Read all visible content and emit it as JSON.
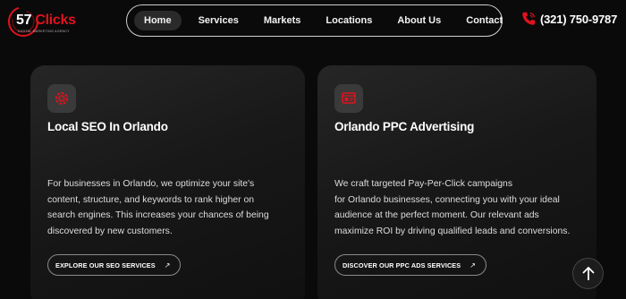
{
  "logo": {
    "number": "57",
    "word": "Clicks",
    "tagline": "DIGITAL MARKETING AGENCY"
  },
  "nav": {
    "items": [
      {
        "label": "Home",
        "active": true
      },
      {
        "label": "Services"
      },
      {
        "label": "Markets"
      },
      {
        "label": "Locations"
      },
      {
        "label": "About Us"
      },
      {
        "label": "Contact"
      }
    ]
  },
  "phone": {
    "number": "(321) 750-9787",
    "icon": "phone-icon"
  },
  "cards": [
    {
      "icon": "seo-gear-icon",
      "title": "Local SEO In Orlando",
      "desc": [
        "For businesses in Orlando, we optimize your site's",
        "content, structure, and keywords to rank higher on",
        "search engines. This increases your chances of being",
        "discovered by new customers."
      ],
      "button": "EXPLORE OUR SEO SERVICES",
      "button_icon": "arrow-up-right-icon"
    },
    {
      "icon": "ppc-ad-icon",
      "title": "Orlando PPC Advertising",
      "desc": [
        "We craft targeted Pay-Per-Click campaigns",
        "for Orlando businesses, connecting you with your ideal",
        "audience at the perfect moment. Our relevant ads",
        "maximize ROI by driving qualified leads and conversions."
      ],
      "button": "DISCOVER OUR PPC ADS SERVICES",
      "button_icon": "arrow-up-right-icon"
    }
  ],
  "scroll_top": {
    "icon": "arrow-up-icon"
  },
  "colors": {
    "accent": "#e0121d",
    "background": "#0a0a0a",
    "card": "#1c1c1c"
  }
}
